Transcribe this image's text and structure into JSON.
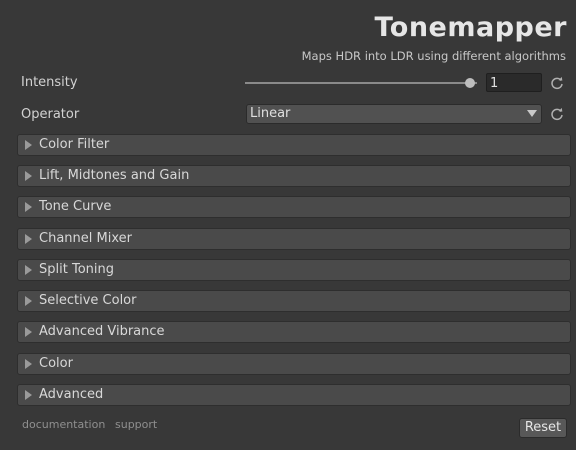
{
  "header": {
    "title": "Tonemapper",
    "subtitle": "Maps HDR into LDR using different algorithms"
  },
  "intensity": {
    "label": "Intensity",
    "value": "1",
    "slider_fraction": 0.97
  },
  "operator": {
    "label": "Operator",
    "selected": "Linear"
  },
  "sections": [
    {
      "label": "Color Filter"
    },
    {
      "label": "Lift, Midtones and Gain"
    },
    {
      "label": "Tone Curve"
    },
    {
      "label": "Channel Mixer"
    },
    {
      "label": "Split Toning"
    },
    {
      "label": "Selective Color"
    },
    {
      "label": "Advanced Vibrance"
    },
    {
      "label": "Color"
    },
    {
      "label": "Advanced"
    }
  ],
  "footer": {
    "documentation": "documentation",
    "support": "support",
    "reset": "Reset"
  },
  "colors": {
    "background": "#383838",
    "section_bg": "#4a4a4a",
    "text": "#d8d8d8"
  }
}
